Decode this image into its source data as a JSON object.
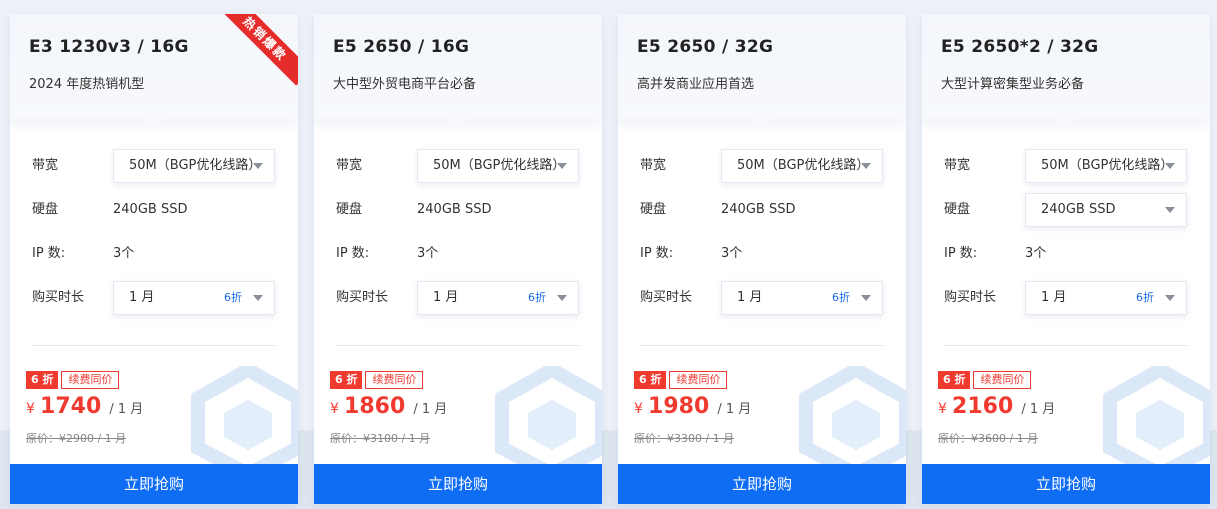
{
  "colors": {
    "accent": "#0f6cf4",
    "price": "#f03a2f",
    "link": "#1468e5"
  },
  "labels": {
    "bandwidth": "带宽",
    "disk": "硬盘",
    "ip": "IP 数:",
    "duration": "购买时长",
    "buy": "立即抢购"
  },
  "cards": [
    {
      "title": "E3 1230v3 / 16G",
      "subtitle": "2024 年度热销机型",
      "ribbon": "热销爆款",
      "bandwidth": "50M（BGP优化线路）",
      "disk": "240GB SSD",
      "ip": "3个",
      "duration": "1 月",
      "duration_badge": "6折",
      "discount_tag": "6 折",
      "renew_tag": "续费同价",
      "currency": "¥",
      "price": "1740",
      "price_unit": "/ 1 月",
      "original_price": "原价：¥2900 / 1 月"
    },
    {
      "title": "E5 2650 / 16G",
      "subtitle": "大中型外贸电商平台必备",
      "bandwidth": "50M（BGP优化线路）",
      "disk": "240GB SSD",
      "ip": "3个",
      "duration": "1 月",
      "duration_badge": "6折",
      "discount_tag": "6 折",
      "renew_tag": "续费同价",
      "currency": "¥",
      "price": "1860",
      "price_unit": "/ 1 月",
      "original_price": "原价：¥3100 / 1 月"
    },
    {
      "title": "E5 2650 / 32G",
      "subtitle": "高并发商业应用首选",
      "bandwidth": "50M（BGP优化线路）",
      "disk": "240GB SSD",
      "ip": "3个",
      "duration": "1 月",
      "duration_badge": "6折",
      "discount_tag": "6 折",
      "renew_tag": "续费同价",
      "currency": "¥",
      "price": "1980",
      "price_unit": "/ 1 月",
      "original_price": "原价：¥3300 / 1 月"
    },
    {
      "title": "E5 2650*2 / 32G",
      "subtitle": "大型计算密集型业务必备",
      "bandwidth": "50M（BGP优化线路）",
      "disk": "240GB SSD",
      "ip": "3个",
      "duration": "1 月",
      "duration_badge": "6折",
      "discount_tag": "6 折",
      "renew_tag": "续费同价",
      "currency": "¥",
      "price": "2160",
      "price_unit": "/ 1 月",
      "original_price": "原价：¥3600 / 1 月"
    }
  ]
}
